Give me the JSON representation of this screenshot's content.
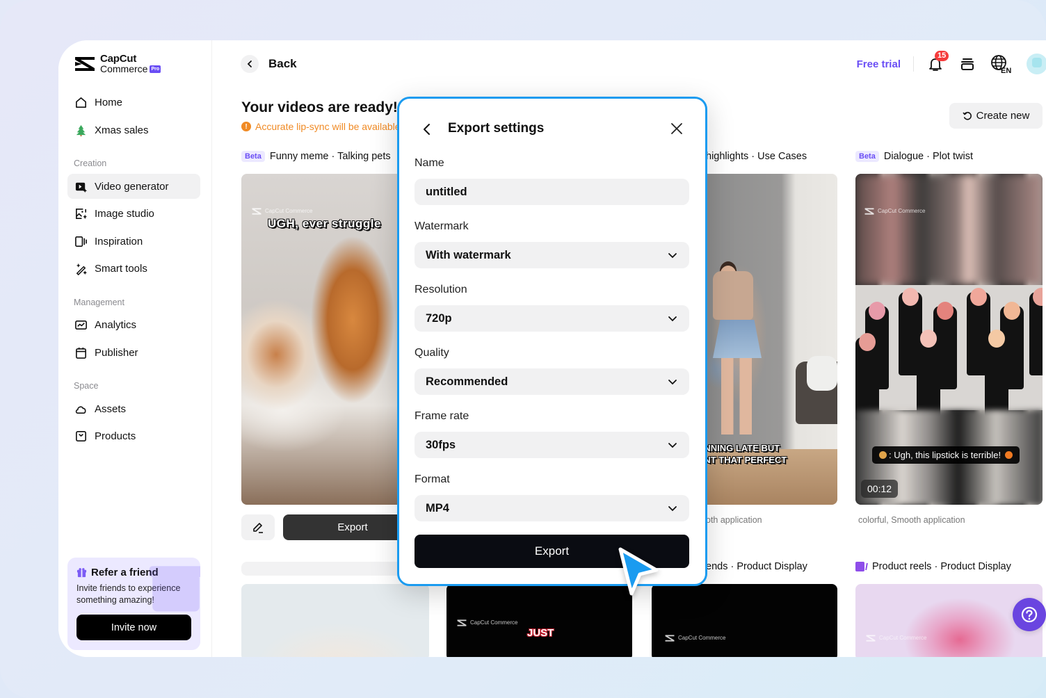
{
  "brand": {
    "name_line1": "CapCut",
    "name_line2": "Commerce",
    "badge": "Pro"
  },
  "sidebar": {
    "top_items": [
      {
        "label": "Home",
        "icon": "home-icon"
      },
      {
        "label": "Xmas sales",
        "icon": "xmas-tree-icon"
      }
    ],
    "sections": [
      {
        "title": "Creation",
        "items": [
          {
            "label": "Video generator",
            "icon": "video-generator-icon",
            "active": true
          },
          {
            "label": "Image studio",
            "icon": "image-studio-icon"
          },
          {
            "label": "Inspiration",
            "icon": "inspiration-icon"
          },
          {
            "label": "Smart tools",
            "icon": "magic-wand-icon"
          }
        ]
      },
      {
        "title": "Management",
        "items": [
          {
            "label": "Analytics",
            "icon": "analytics-icon"
          },
          {
            "label": "Publisher",
            "icon": "calendar-icon"
          }
        ]
      },
      {
        "title": "Space",
        "items": [
          {
            "label": "Assets",
            "icon": "cloud-icon"
          },
          {
            "label": "Products",
            "icon": "product-box-icon"
          }
        ]
      }
    ],
    "refer": {
      "title": "Refer a friend",
      "description": "Invite friends to experience something amazing!",
      "button": "Invite now"
    }
  },
  "header": {
    "back_label": "Back",
    "free_trial": "Free trial",
    "notification_count": "15",
    "language": "EN"
  },
  "main": {
    "title": "Your videos are ready!",
    "notice": "Accurate lip-sync will be available",
    "create_new": "Create new",
    "cards": [
      {
        "badge": "Beta",
        "label": "Funny meme · Talking pets",
        "caption": "UGH, ever struggle",
        "watermark": "CapCut Commerce",
        "actions": {
          "export": "Export"
        }
      },
      {
        "label": "highlights · Use Cases",
        "caption_line1": "UNNING LATE BUT",
        "caption_line2": "ANT THAT PERFECT",
        "description": "oth application"
      },
      {
        "badge": "Beta",
        "label": "Dialogue · Plot twist",
        "caption": ": Ugh, this lipstick is terrible!",
        "duration": "00:12",
        "description": "colorful, Smooth application",
        "watermark": "CapCut Commerce"
      }
    ],
    "row2": [
      {
        "label": "",
        "watermark": ""
      },
      {
        "label": "",
        "caption": "JUST",
        "watermark": "CapCut Commerce"
      },
      {
        "label": "ends · Product Display",
        "watermark": "CapCut Commerce"
      },
      {
        "label": "Product reels · Product Display",
        "watermark": "CapCut Commerce"
      }
    ]
  },
  "modal": {
    "title": "Export settings",
    "fields": [
      {
        "label": "Name",
        "value": "untitled",
        "type": "text"
      },
      {
        "label": "Watermark",
        "value": "With watermark",
        "type": "select"
      },
      {
        "label": "Resolution",
        "value": "720p",
        "type": "select"
      },
      {
        "label": "Quality",
        "value": "Recommended",
        "type": "select"
      },
      {
        "label": "Frame rate",
        "value": "30fps",
        "type": "select"
      },
      {
        "label": "Format",
        "value": "MP4",
        "type": "select"
      }
    ],
    "export_button": "Export"
  },
  "colors": {
    "accent": "#6a4ef5",
    "modal_border": "#1a9bf0",
    "notice": "#f08a24",
    "notification_badge": "#f53b3b"
  }
}
